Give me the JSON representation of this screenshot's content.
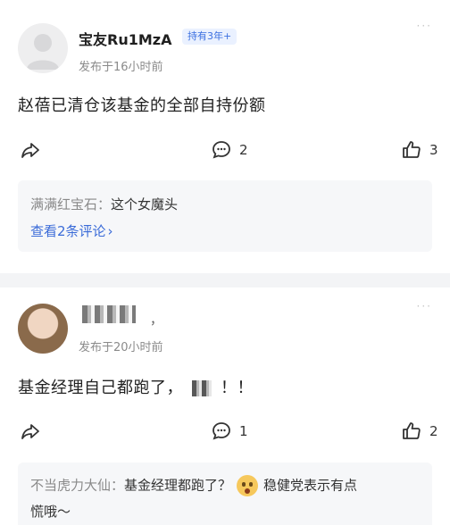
{
  "posts": [
    {
      "username": "宝友Ru1MzA",
      "badge": "持有3年+",
      "timestamp": "发布于16小时前",
      "content": "赵蓓已清仓该基金的全部自持份额",
      "comment_count": "2",
      "like_count": "3",
      "reply": {
        "user": "满满红宝石：",
        "text": "这个女魔头"
      },
      "view_more": "查看2条评论"
    },
    {
      "username": "",
      "name_suffix": "，",
      "timestamp": "发布于20小时前",
      "content_before": "基金经理自己都跑了，",
      "content_after": "！！",
      "comment_count": "1",
      "like_count": "2",
      "reply": {
        "user": "不当虎力大仙：",
        "text_before": "基金经理都跑了？",
        "text_after": "稳健党表示有点",
        "text_line2": "慌哦～"
      }
    }
  ],
  "more_icon": "···"
}
